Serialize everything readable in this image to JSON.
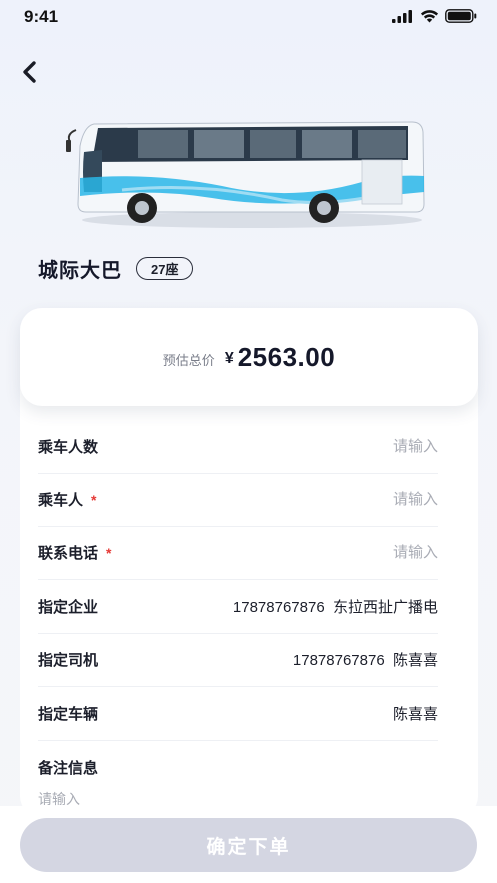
{
  "status_bar": {
    "time": "9:41"
  },
  "vehicle": {
    "title": "城际大巴",
    "seats": "27座"
  },
  "price": {
    "label": "预估总价",
    "currency": "¥",
    "amount": "2563.00"
  },
  "form": {
    "passenger_count": {
      "label": "乘车人数",
      "placeholder": "请输入",
      "required": false
    },
    "passenger": {
      "label": "乘车人",
      "placeholder": "请输入",
      "required": true
    },
    "phone": {
      "label": "联系电话",
      "placeholder": "请输入",
      "required": true
    },
    "company": {
      "label": "指定企业",
      "value": "17878767876  东拉西扯广播电"
    },
    "driver": {
      "label": "指定司机",
      "value": "17878767876  陈喜喜"
    },
    "car": {
      "label": "指定车辆",
      "value": "陈喜喜"
    },
    "remark": {
      "label": "备注信息",
      "placeholder": "请输入"
    },
    "required_mark": "*"
  },
  "submit": {
    "label": "确定下单"
  },
  "colors": {
    "accent": "#d4d6e2",
    "required": "#e53935",
    "bus_stripe": "#29b6e8"
  }
}
